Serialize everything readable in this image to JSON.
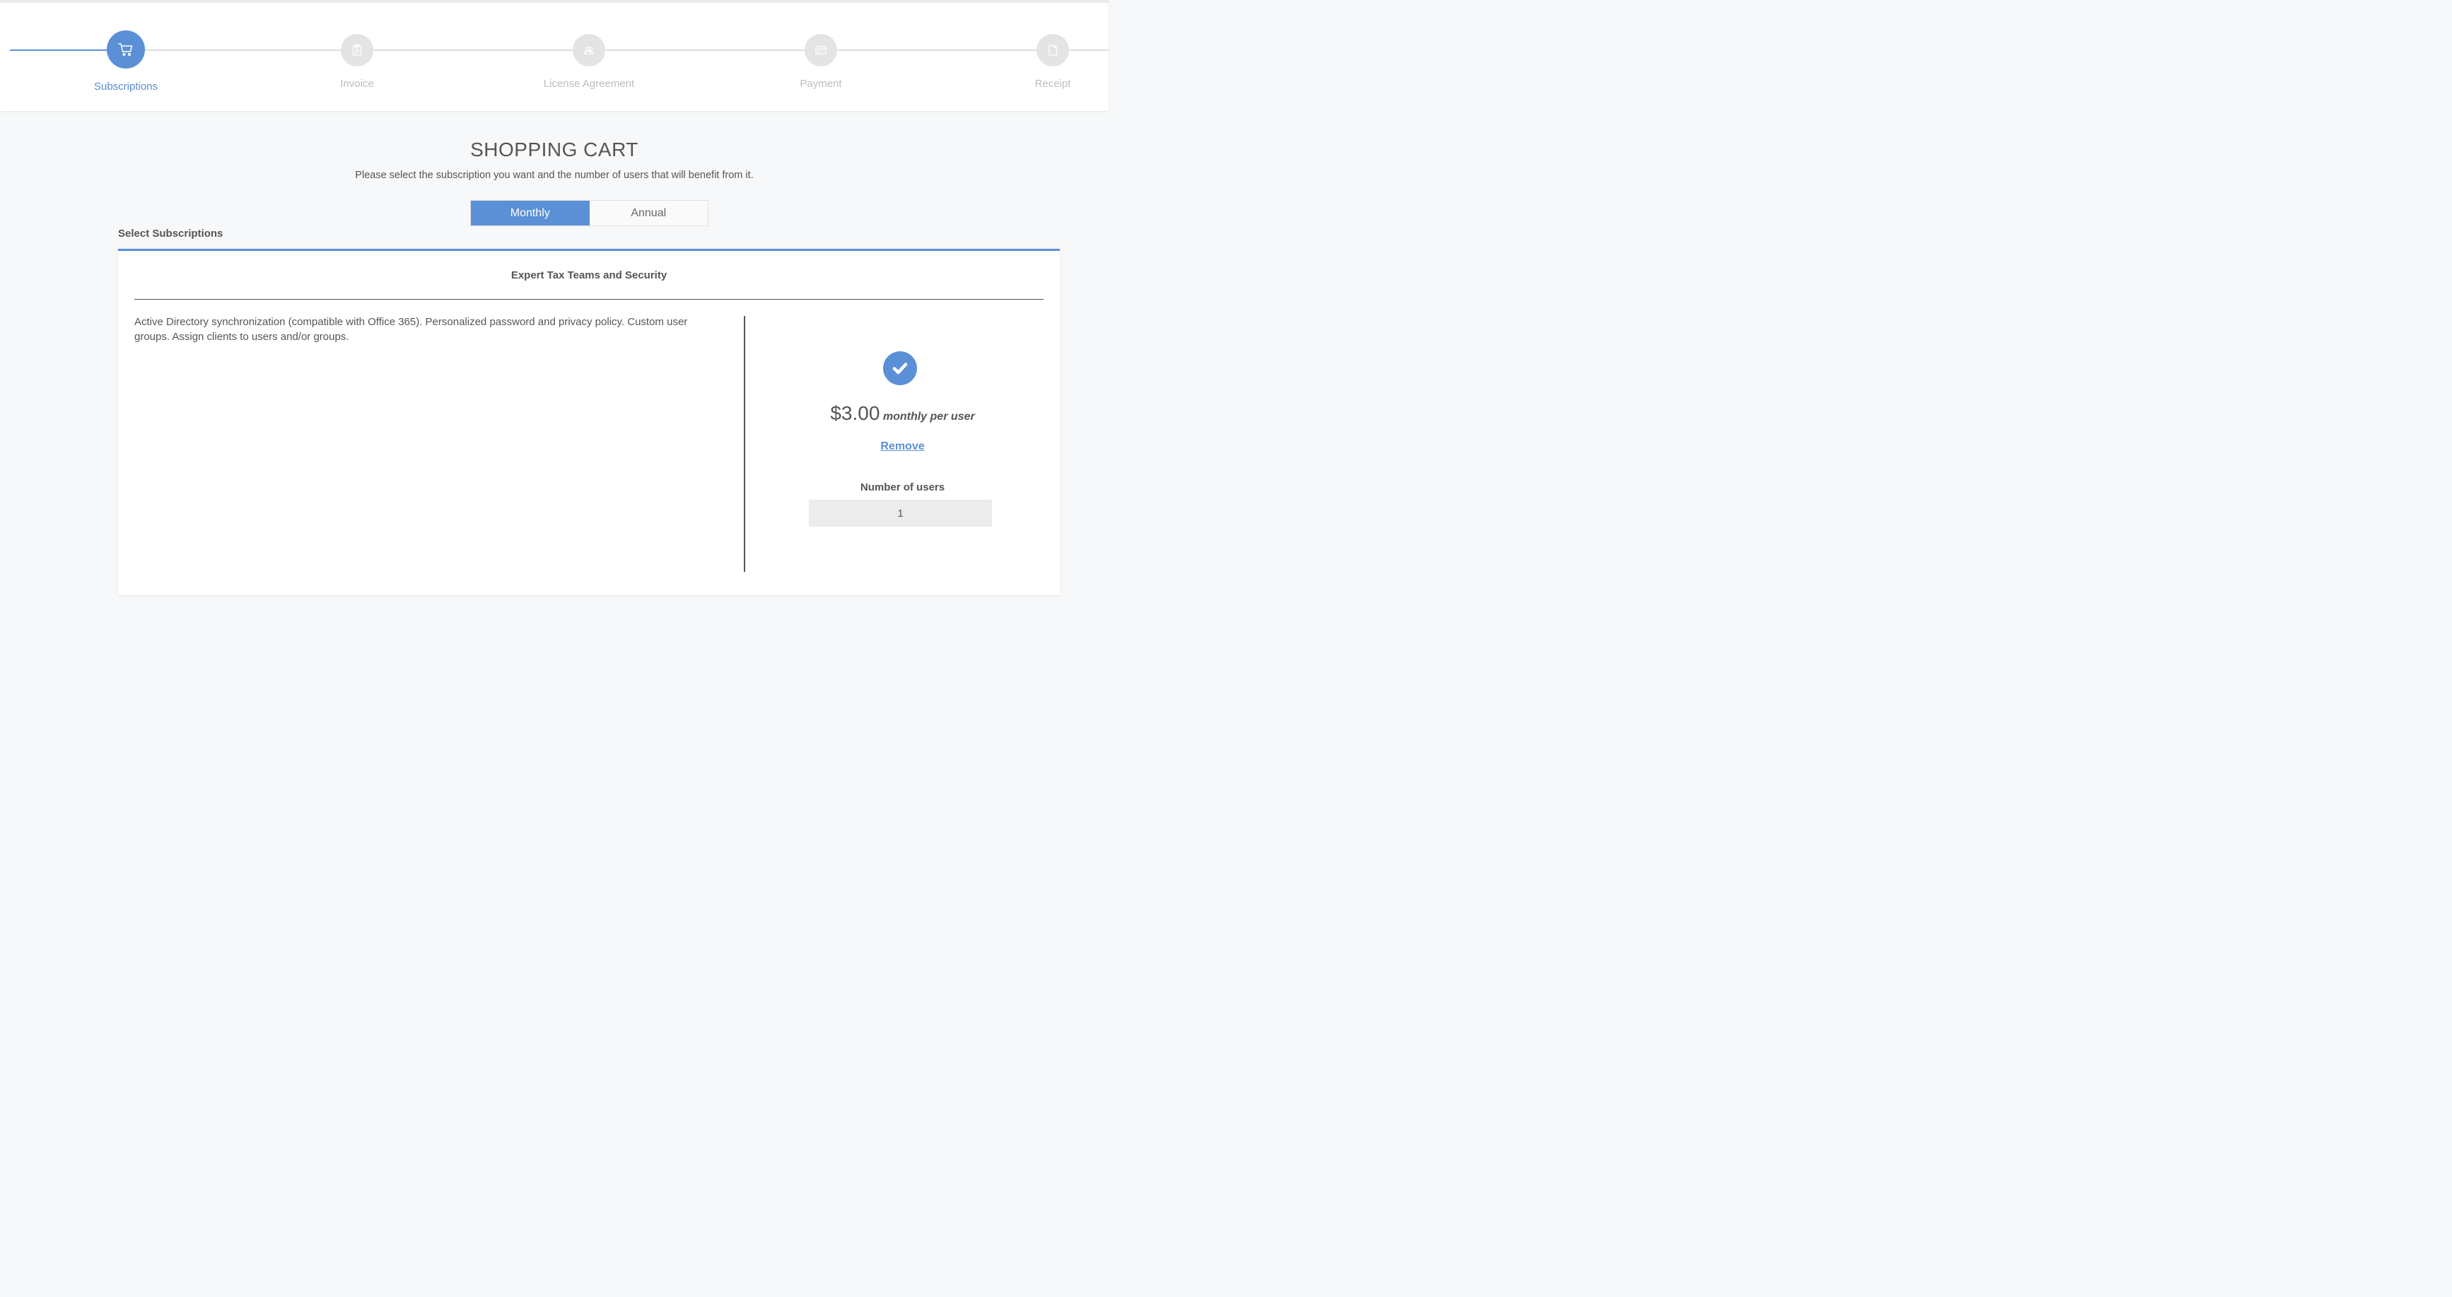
{
  "stepper": {
    "steps": [
      {
        "label": "Subscriptions",
        "icon": "cart-icon",
        "state": "active"
      },
      {
        "label": "Invoice",
        "icon": "clipboard-icon",
        "state": "pending"
      },
      {
        "label": "License Agreement",
        "icon": "users-icon",
        "state": "pending"
      },
      {
        "label": "Payment",
        "icon": "card-icon",
        "state": "pending"
      },
      {
        "label": "Receipt",
        "icon": "document-icon",
        "state": "pending"
      }
    ]
  },
  "header": {
    "title": "SHOPPING CART",
    "subtitle": "Please select the subscription you want and the number of users that will benefit from it."
  },
  "billing_toggle": {
    "options": [
      "Monthly",
      "Annual"
    ],
    "selected": "Monthly"
  },
  "section_label": "Select Subscriptions",
  "subscription": {
    "name": "Expert Tax Teams and Security",
    "description": "Active Directory synchronization (compatible with Office 365). Personalized password and privacy policy. Custom user groups. Assign clients to users and/or groups.",
    "selected": true,
    "price": "$3.00",
    "price_unit": "monthly per user",
    "remove_label": "Remove",
    "users_label": "Number of users",
    "users_value": "1"
  },
  "colors": {
    "accent": "#5b90d6",
    "inactive_step": "#e4e4e4",
    "text": "#555555"
  }
}
